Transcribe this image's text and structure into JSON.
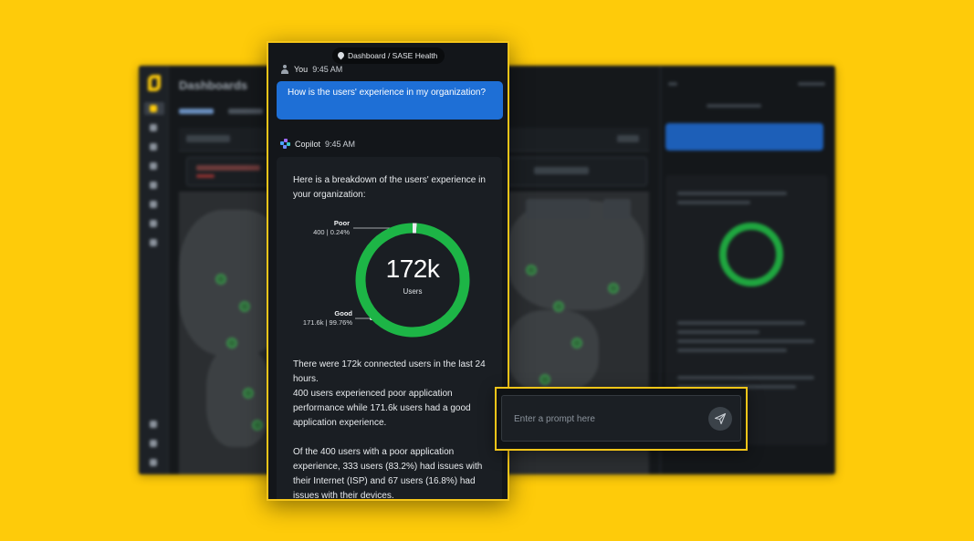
{
  "breadcrumb": "Dashboard / SASE Health",
  "background_app": {
    "title": "Dashboards"
  },
  "user_message": {
    "author": "You",
    "time": "9:45 AM",
    "text": "How is the users' experience in my organization?"
  },
  "copilot_message": {
    "author": "Copilot",
    "time": "9:45 AM",
    "intro": "Here is a breakdown of the users' experience in your organization:",
    "summary_p1_a": "There were 172k connected users in the last 24 hours.",
    "summary_p1_b": "400 users experienced poor application performance while 171.6k users had a good application experience.",
    "summary_p2": "Of the 400 users with a poor application experience, 333 users (83.2%) had issues with their Internet (ISP) and 67 users (16.8%) had issues with their devices."
  },
  "chart_data": {
    "type": "pie",
    "center_value": "172k",
    "center_label": "Users",
    "slices": [
      {
        "name": "Poor",
        "label": "400 | 0.24%",
        "value": 0.24,
        "color": "#E8ECEF"
      },
      {
        "name": "Good",
        "label": "171.6k | 99.76%",
        "value": 99.76,
        "color": "#1DB546"
      }
    ]
  },
  "prompt": {
    "placeholder": "Enter a prompt here"
  },
  "colors": {
    "accent": "#FECB0A",
    "user_bubble": "#1E6FD6",
    "good": "#1DB546"
  },
  "icons": [
    "pin-icon",
    "user-icon",
    "copilot-icon",
    "send-icon"
  ]
}
